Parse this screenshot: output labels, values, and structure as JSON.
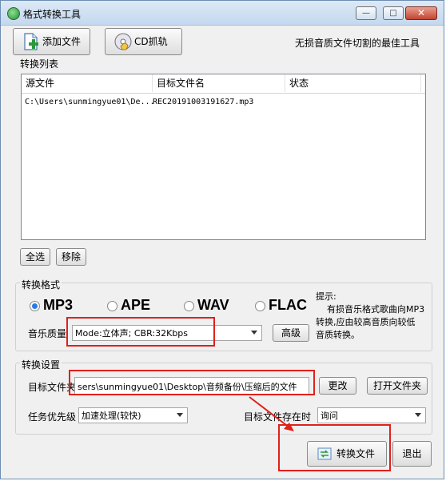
{
  "window": {
    "title": "格式转换工具",
    "minimize_glyph": "—",
    "maximize_glyph": "□",
    "close_glyph": "✕"
  },
  "toolbar": {
    "add_file_label": "添加文件",
    "add_file_icon": "document-add-icon",
    "cd_rip_label": "CD抓轨",
    "cd_rip_icon": "cd-hand-icon",
    "slogan": "无损音质文件切割的最佳工具"
  },
  "conversion_list": {
    "title": "转换列表",
    "columns": [
      "源文件",
      "目标文件名",
      "状态"
    ],
    "rows": [
      {
        "source": "C:\\Users\\sunmingyue01\\De...",
        "target": "REC20191003191627.mp3",
        "status": ""
      }
    ],
    "select_all_label": "全选",
    "remove_label": "移除"
  },
  "format": {
    "title": "转换格式",
    "options": [
      "MP3",
      "APE",
      "WAV",
      "FLAC"
    ],
    "selected": "MP3",
    "quality_label": "音乐质量",
    "quality_value": "Mode:立体声; CBR:32Kbps",
    "advanced_label": "高级",
    "hint_lines": [
      "提示:",
      "    有损音乐格式歌曲向MP3",
      "转换,应由较高音质向较低",
      "音质转换。"
    ]
  },
  "settings": {
    "title": "转换设置",
    "target_folder_label": "目标文件夹",
    "target_folder_value": "sers\\sunmingyue01\\Desktop\\音频备份\\压缩后的文件",
    "change_label": "更改",
    "open_folder_label": "打开文件夹",
    "priority_label": "任务优先级",
    "priority_value": "加速处理(较快)",
    "exists_label": "目标文件存在时",
    "exists_value": "询问"
  },
  "actions": {
    "convert_label": "转换文件",
    "convert_icon": "convert-arrows-icon",
    "exit_label": "退出"
  },
  "colors": {
    "annotation_red": "#e0201c",
    "radio_selected": "#2a7be3"
  }
}
